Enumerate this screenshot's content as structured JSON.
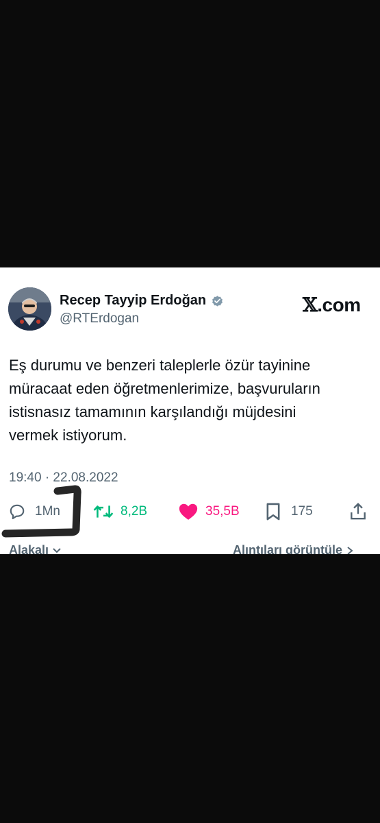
{
  "author": {
    "name": "Recep Tayyip Erdoğan",
    "handle": "@RTErdogan",
    "verified_icon": "verified-badge-icon"
  },
  "brand": {
    "label_x": "𝕏",
    "label_rest": ".com"
  },
  "tweet": {
    "line1": "Eş durumu ve benzeri taleplerle özür tayinine",
    "line2": "müracaat eden öğretmenlerimize, başvuruların",
    "line3": "istisnasız tamamının karşılandığı müjdesini",
    "line4": "vermek istiyorum.",
    "timestamp": "19:40 · 22.08.2022"
  },
  "actions": {
    "replies": "1Mn",
    "retweets": "8,2B",
    "likes": "35,5B",
    "bookmarks": "175"
  },
  "links": {
    "related": "Alakalı",
    "quotes": "Alıntıları görüntüle"
  },
  "colors": {
    "retweet": "#00ba7c",
    "like": "#f91880",
    "secondary": "#536471",
    "primary": "#0f1419",
    "verified": "#829aab"
  }
}
